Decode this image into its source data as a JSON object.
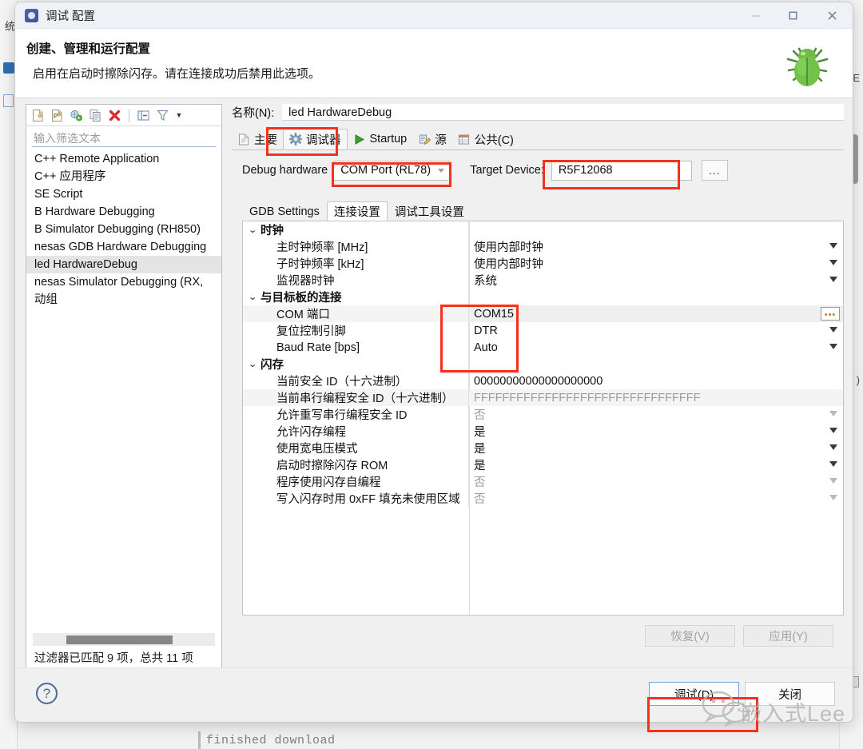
{
  "window": {
    "title": "调试 配置",
    "app_icon": "debug-config-icon",
    "controls": {
      "minimize": "minimize-icon",
      "maximize": "maximize-icon",
      "close": "close-icon"
    }
  },
  "header": {
    "title": "创建、管理和运行配置",
    "subtitle": "启用在启动时擦除闪存。请在连接成功后禁用此选项。",
    "illustration": "green-bug-icon"
  },
  "left_panel": {
    "toolbar": [
      {
        "name": "new-launch-configuration-icon",
        "glyph": "new-config"
      },
      {
        "name": "new-prototype-icon",
        "glyph": "new-prototype"
      },
      {
        "name": "export-icon",
        "glyph": "export"
      },
      {
        "name": "duplicate-icon",
        "glyph": "duplicate"
      },
      {
        "name": "delete-icon",
        "glyph": "delete"
      },
      {
        "name": "collapse-all-icon",
        "glyph": "collapse"
      },
      {
        "name": "filter-icon",
        "glyph": "filter"
      },
      {
        "name": "view-menu-arrow-icon",
        "glyph": "chevron-down"
      }
    ],
    "filter_placeholder": "输入筛选文本",
    "filter_value": "",
    "items": [
      {
        "label": "C++ Remote Application",
        "selected": false
      },
      {
        "label": "C++ 应用程序",
        "selected": false
      },
      {
        "label": "SE Script",
        "selected": false
      },
      {
        "label": "B Hardware Debugging",
        "selected": false
      },
      {
        "label": "B Simulator Debugging (RH850)",
        "selected": false
      },
      {
        "label": "nesas GDB Hardware Debugging",
        "selected": false
      },
      {
        "label": "led HardwareDebug",
        "selected": true
      },
      {
        "label": "nesas Simulator Debugging (RX,",
        "selected": false
      },
      {
        "label": "动组",
        "selected": false
      }
    ],
    "status": "过滤器已匹配 9 项，总共 11 项"
  },
  "right_panel": {
    "name_label": "名称(N):",
    "name_value": "led HardwareDebug",
    "tabs": [
      {
        "label": "主要",
        "icon": "document-icon",
        "active": false
      },
      {
        "label": "调试器",
        "icon": "debugger-gear-icon",
        "active": true
      },
      {
        "label": "Startup",
        "icon": "green-play-icon",
        "active": false
      },
      {
        "label": "源",
        "icon": "source-folder-icon",
        "active": false
      },
      {
        "label": "公共(C)",
        "icon": "common-table-icon",
        "active": false
      }
    ],
    "debug_hardware_label": "Debug hardware",
    "debug_hardware_value": "COM Port (RL78)",
    "target_device_label": "Target Device:",
    "target_device_value": "R5F12068",
    "browse_button": "...",
    "subtabs": [
      {
        "label": "GDB Settings",
        "active": false
      },
      {
        "label": "连接设置",
        "active": true
      },
      {
        "label": "调试工具设置",
        "active": false
      }
    ],
    "properties": [
      {
        "kind": "group",
        "name": "时钟",
        "value": "",
        "twisty": "∨"
      },
      {
        "kind": "child",
        "name": "主时钟频率 [MHz]",
        "value": "使用内部时钟",
        "control": "dropdown"
      },
      {
        "kind": "child",
        "name": "子时钟频率 [kHz]",
        "value": "使用内部时钟",
        "control": "dropdown"
      },
      {
        "kind": "child",
        "name": "监视器时钟",
        "value": "系统",
        "control": "dropdown"
      },
      {
        "kind": "group",
        "name": "与目标板的连接",
        "value": "",
        "twisty": "∨"
      },
      {
        "kind": "child",
        "name": "COM 端口",
        "value": "COM15",
        "control": "browse",
        "highlight": true
      },
      {
        "kind": "child",
        "name": "复位控制引脚",
        "value": "DTR",
        "control": "dropdown"
      },
      {
        "kind": "child",
        "name": "Baud Rate [bps]",
        "value": "Auto",
        "control": "dropdown"
      },
      {
        "kind": "group",
        "name": "闪存",
        "value": "",
        "twisty": "∨"
      },
      {
        "kind": "child",
        "name": "当前安全 ID（十六进制）",
        "value": "00000000000000000000",
        "control": "none"
      },
      {
        "kind": "child",
        "name": "当前串行编程安全 ID（十六进制）",
        "value": "FFFFFFFFFFFFFFFFFFFFFFFFFFFFFFFF",
        "control": "none",
        "muted": true
      },
      {
        "kind": "child",
        "name": "允许重写串行编程安全 ID",
        "value": "否",
        "control": "dropdown",
        "muted": true,
        "dim": true
      },
      {
        "kind": "child",
        "name": "允许闪存编程",
        "value": "是",
        "control": "dropdown"
      },
      {
        "kind": "child",
        "name": "使用宽电压模式",
        "value": "是",
        "control": "dropdown"
      },
      {
        "kind": "child",
        "name": "启动时擦除闪存 ROM",
        "value": "是",
        "control": "dropdown"
      },
      {
        "kind": "child",
        "name": "程序使用闪存自编程",
        "value": "否",
        "control": "dropdown",
        "muted": true,
        "dim": true
      },
      {
        "kind": "child",
        "name": "写入闪存时用 0xFF 填充未使用区域",
        "value": "否",
        "control": "dropdown",
        "muted": true,
        "dim": true
      }
    ],
    "revert_button": "恢复(V)",
    "apply_button": "应用(Y)"
  },
  "footer": {
    "help_icon": "help-icon",
    "debug_button": "调试(D)",
    "close_button": "关闭"
  },
  "background": {
    "console_text": "finished download",
    "left_strip_chars": "统",
    "right_strip_chars": ")"
  },
  "watermark": {
    "text": "嵌入式Lee",
    "logo": "wechat-icon"
  },
  "annotations": {
    "color": "#f5311d",
    "boxes": [
      {
        "name": "debugger-tab-highlight"
      },
      {
        "name": "debug-hardware-highlight"
      },
      {
        "name": "target-device-highlight"
      },
      {
        "name": "connection-values-highlight"
      },
      {
        "name": "debug-button-highlight"
      }
    ]
  }
}
